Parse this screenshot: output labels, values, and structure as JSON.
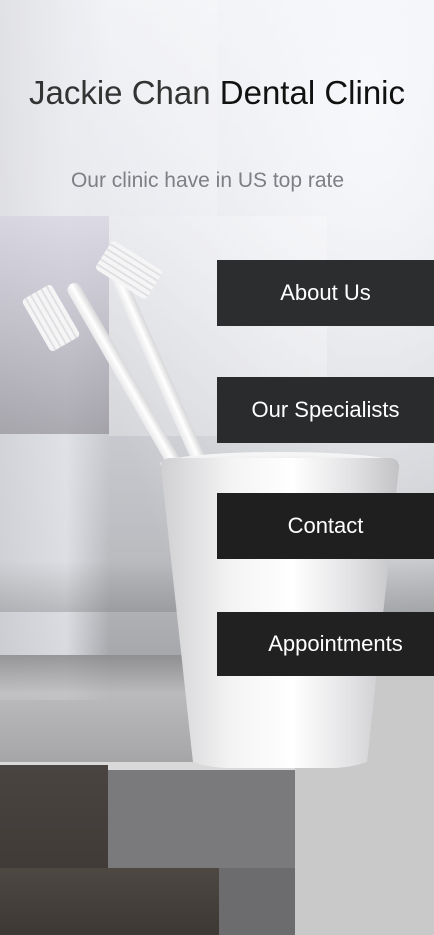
{
  "header": {
    "title_part1": "Jackie Chan",
    "title_part2": "Dental Clinic",
    "subtitle": "Our clinic have in US top rate"
  },
  "nav": {
    "items": [
      {
        "label": "About Us"
      },
      {
        "label": "Our Specialists"
      },
      {
        "label": "Contact"
      },
      {
        "label": "Appointments"
      }
    ]
  },
  "colors": {
    "button_bg": "#2c2d2f",
    "button_text": "#ffffff",
    "title_text": "#222222",
    "subtitle_text": "#7d7f84"
  },
  "background": {
    "image_subject": "toothbrushes-in-white-cup-photo"
  }
}
